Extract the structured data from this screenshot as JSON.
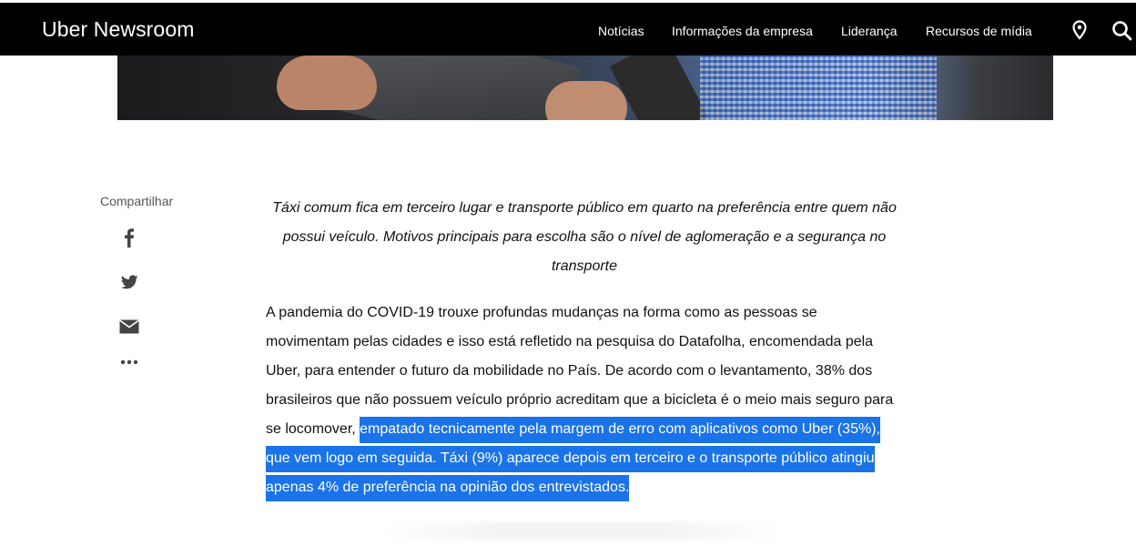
{
  "header": {
    "brand_uber": "Uber",
    "brand_newsroom": "Newsroom",
    "nav": [
      "Notícias",
      "Informações da empresa",
      "Liderança",
      "Recursos de mídia"
    ],
    "icons": [
      "location-pin-icon",
      "search-icon"
    ]
  },
  "share": {
    "label": "Compartilhar",
    "icons": [
      "facebook-icon",
      "twitter-icon",
      "email-icon",
      "more-icon"
    ]
  },
  "article": {
    "subtitle": "Táxi comum fica em terceiro lugar e transporte público em quarto na preferência entre quem não possui veículo. Motivos principais para escolha são o nível de aglomeração e a segurança no transporte",
    "body_plain": "A pandemia do COVID-19 trouxe profundas mudanças na forma como as pessoas se movimentam pelas cidades e isso está refletido na pesquisa do Datafolha, encomendada pela Uber, para entender o futuro da mobilidade no País.  De acordo com o levantamento, 38% dos brasileiros que não possuem veículo próprio acreditam que a bicicleta é o meio mais seguro para se locomover, ",
    "body_selected": "empatado tecnicamente pela margem de erro com aplicativos como Uber (35%), que vem logo em seguida. Táxi (9%) aparece depois em terceiro e o transporte público atingiu apenas 4% de preferência na opinião dos entrevistados."
  },
  "colors": {
    "header_bg": "#000000",
    "selection": "#1a73e8",
    "icon": "#444444"
  }
}
